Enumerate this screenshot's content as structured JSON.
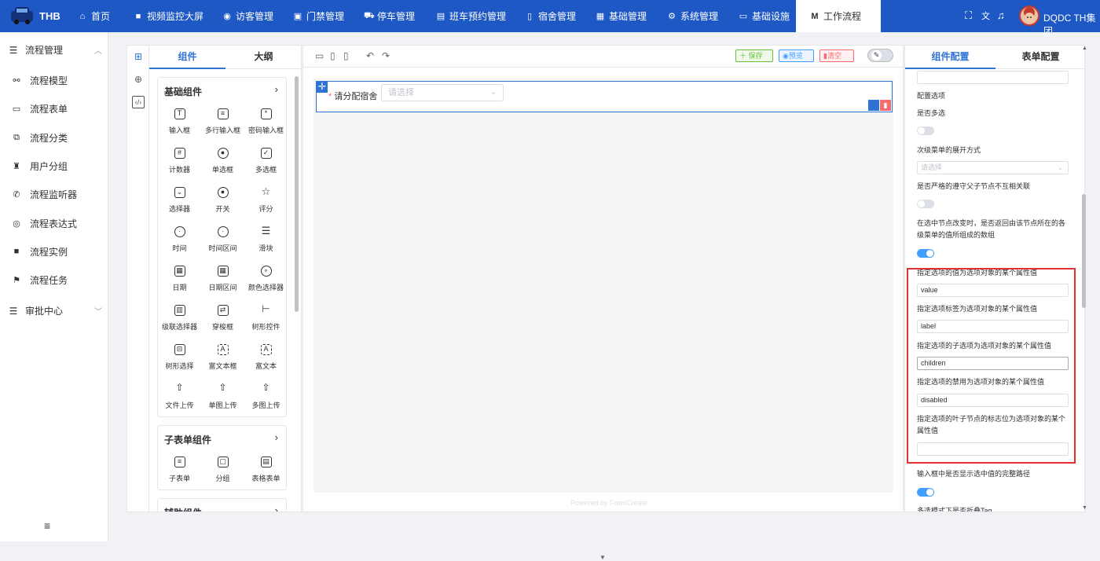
{
  "app": {
    "logo_text": "THB",
    "user": "DQDC TH集团"
  },
  "nav": [
    {
      "label": "首页",
      "icon": "home-icon",
      "glyph": "⌂"
    },
    {
      "label": "视频监控大屏",
      "icon": "video-icon",
      "glyph": "■"
    },
    {
      "label": "访客管理",
      "icon": "location-icon",
      "glyph": "◉"
    },
    {
      "label": "门禁管理",
      "icon": "door-icon",
      "glyph": "▣"
    },
    {
      "label": "停车管理",
      "icon": "car-icon",
      "glyph": "⛟"
    },
    {
      "label": "班车预约管理",
      "icon": "bus-icon",
      "glyph": "▤"
    },
    {
      "label": "宿舍管理",
      "icon": "dorm-icon",
      "glyph": "▯"
    },
    {
      "label": "基础管理",
      "icon": "calendar-icon",
      "glyph": "▦"
    },
    {
      "label": "系统管理",
      "icon": "gear-icon",
      "glyph": "⚙"
    },
    {
      "label": "基础设施",
      "icon": "monitor-icon",
      "glyph": "▭"
    },
    {
      "label": "工作流程",
      "icon": "workflow-icon",
      "glyph": "M"
    }
  ],
  "topright": [
    {
      "icon": "fullscreen-icon",
      "glyph": "⛶"
    },
    {
      "icon": "translate-icon",
      "glyph": "文"
    },
    {
      "icon": "bell-icon",
      "glyph": "♫"
    }
  ],
  "sidebar": {
    "group1": "流程管理",
    "items": [
      {
        "label": "流程模型",
        "icon": "model-icon",
        "glyph": "⚯"
      },
      {
        "label": "流程表单",
        "icon": "form-icon",
        "glyph": "▭"
      },
      {
        "label": "流程分类",
        "icon": "category-icon",
        "glyph": "⧉"
      },
      {
        "label": "用户分组",
        "icon": "group-icon",
        "glyph": "♜"
      },
      {
        "label": "流程监听器",
        "icon": "listener-icon",
        "glyph": "✆"
      },
      {
        "label": "流程表达式",
        "icon": "expression-icon",
        "glyph": "◎"
      },
      {
        "label": "流程实例",
        "icon": "instance-icon",
        "glyph": "■"
      },
      {
        "label": "流程任务",
        "icon": "task-icon",
        "glyph": "⚑"
      }
    ],
    "group2": "审批中心"
  },
  "components": {
    "tabs": [
      "组件",
      "大纲"
    ],
    "basic": {
      "title": "基础组件",
      "items": [
        "输入框",
        "多行输入框",
        "密码输入框",
        "计数器",
        "单选框",
        "多选框",
        "选择器",
        "开关",
        "评分",
        "时间",
        "时间区间",
        "滑块",
        "日期",
        "日期区间",
        "颜色选择器",
        "级联选择器",
        "穿梭框",
        "树形控件",
        "树形选择",
        "富文本框",
        "富文本",
        "文件上传",
        "单图上传",
        "多图上传"
      ]
    },
    "sub": {
      "title": "子表单组件",
      "items": [
        "子表单",
        "分组",
        "表格表单"
      ]
    },
    "aux": {
      "title": "辅助组件"
    }
  },
  "toolbar": {
    "save": "保存",
    "preview": "预览",
    "clear": "清空"
  },
  "canvas": {
    "field_label": "请分配宿舍",
    "required_mark": "*",
    "select_placeholder": "请选择",
    "powered": "Powered by FormCreate"
  },
  "config": {
    "tabs": [
      "组件配置",
      "表单配置"
    ],
    "section": "配置选项",
    "multi_label": "是否多选",
    "expand_label": "次级菜单的展开方式",
    "expand_placeholder": "请选择",
    "strict_label": "是否严格的遵守父子节点不互相关联",
    "emit_path_label": "在选中节点改变时，是否返回由该节点所在的各级菜单的值所组成的数组",
    "value_label": "指定选项的值为选项对象的某个属性值",
    "value_value": "value",
    "label_label": "指定选项标签为选项对象的某个属性值",
    "label_value": "label",
    "children_label": "指定选项的子选项为选项对象的某个属性值",
    "children_value": "children",
    "disabled_label": "指定选项的禁用为选项对象的某个属性值",
    "disabled_value": "disabled",
    "leaf_label": "指定选项的叶子节点的标志位为选项对象的某个属性值",
    "leaf_value": "",
    "full_path_label": "输入框中是否显示选中值的完整路径",
    "collapse_tags_label": "多选模式下是否折叠Tag"
  }
}
